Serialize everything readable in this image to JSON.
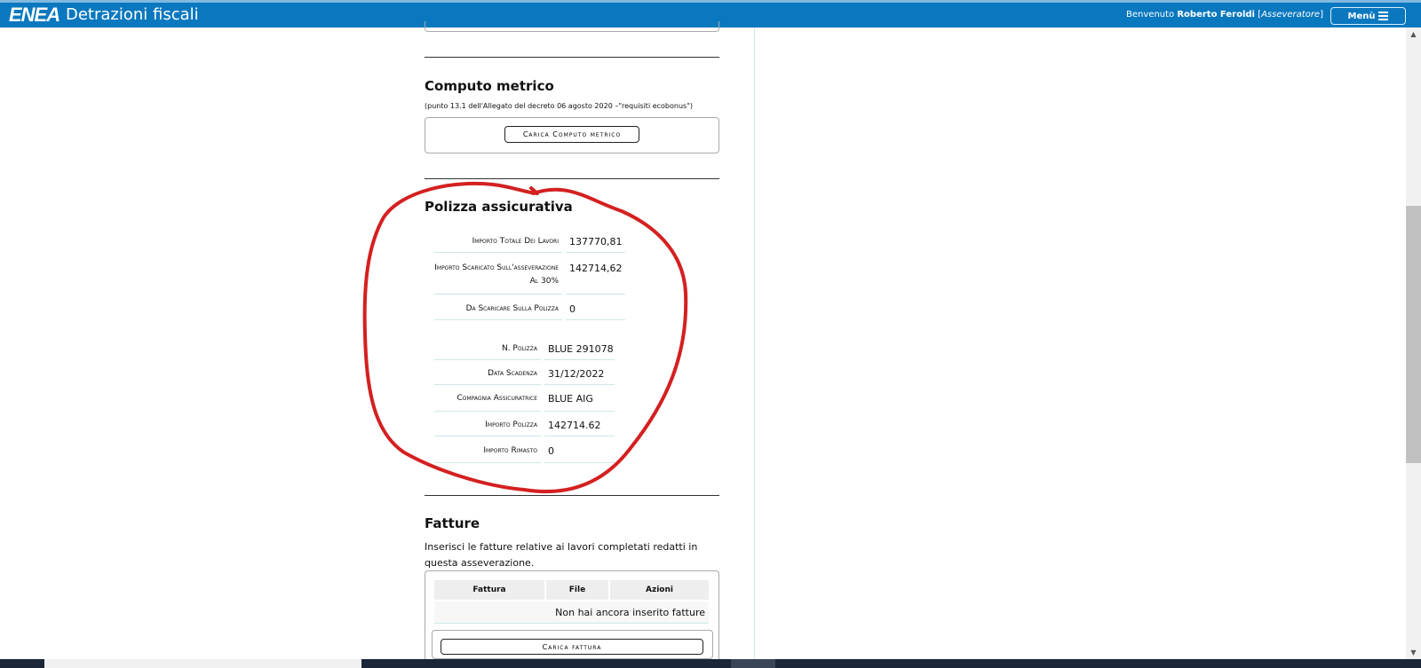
{
  "header": {
    "app_title": "Detrazioni fiscali",
    "logo_text": "ENEA",
    "welcome_prefix": "Benvenuto",
    "user_name": "Roberto Feroldi",
    "user_role": "Asseveratore",
    "menu_label": "Menù",
    "brand_color": "#0a78bf"
  },
  "computo": {
    "title": "Computo metrico",
    "note": "(punto 13.1 dell'Allegato del decreto 06 agosto 2020 –\"requisiti ecobonus\")",
    "button_label": "Carica Computo metrico"
  },
  "polizza": {
    "title": "Polizza assicurativa",
    "summary": [
      {
        "label": "Importo Totale Dei Lavori",
        "value": "137770,81"
      },
      {
        "label": "Importo Scaricato Sull'asseverazione Al 30%",
        "value": "142714,62"
      },
      {
        "label": "Da Scaricare Sulla Polizza",
        "value": "0"
      }
    ],
    "details": [
      {
        "label": "N. Polizza",
        "value": "BLUE 291078"
      },
      {
        "label": "Data Scadenza",
        "value": "31/12/2022"
      },
      {
        "label": "Compagnia Assicuratrice",
        "value": "BLUE AIG"
      },
      {
        "label": "Importo Polizza",
        "value": "142714.62"
      },
      {
        "label": "Importo Rimasto",
        "value": "0"
      }
    ]
  },
  "fatture": {
    "title": "Fatture",
    "intro": "Inserisci le fatture relative ai lavori completati redatti in questa asseverazione.",
    "columns": [
      "Fattura",
      "File",
      "Azioni"
    ],
    "empty_message": "Non hai ancora inserito fatture",
    "button_label": "Carica fattura"
  },
  "annotation_color": "#d42020"
}
